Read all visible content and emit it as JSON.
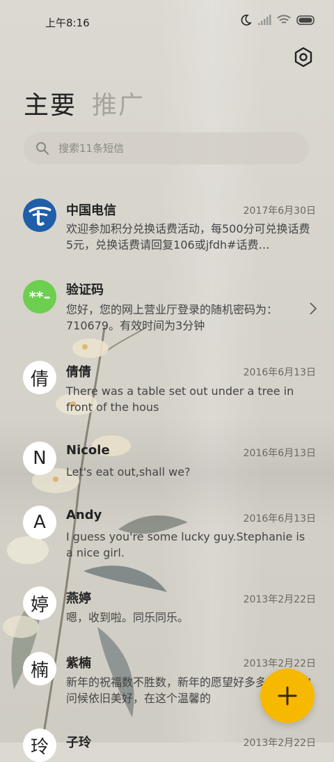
{
  "status": {
    "time": "上午8:16"
  },
  "tabs": [
    {
      "label": "主要"
    },
    {
      "label": "推广"
    }
  ],
  "search": {
    "placeholder": "搜索11条短信"
  },
  "conversations": [
    {
      "name": "中国电信",
      "date": "2017年6月30日",
      "snippet": "欢迎参加积分兑换话费活动，每500分可兑换话费5元，兑换话费请回复106或jfdh#话费…",
      "avatar": "",
      "avatar_type": "telecom-logo"
    },
    {
      "name": "验证码",
      "date": "",
      "snippet": "您好，您的网上营业厅登录的随机密码为：710679。有效时间为3分钟",
      "avatar": "**–",
      "avatar_type": "code",
      "avatar_color": "#6ccf4f"
    },
    {
      "name": "倩倩",
      "date": "2016年6月13日",
      "snippet": "There was a table set out under a tree in front of the hous",
      "avatar": "倩"
    },
    {
      "name": "Nicole",
      "date": "2016年6月13日",
      "snippet": "Let's eat out,shall we?",
      "avatar": "N"
    },
    {
      "name": "Andy",
      "date": "2016年6月13日",
      "snippet": "I guess you're some lucky guy.Stephanie is a nice girl.",
      "avatar": "A"
    },
    {
      "name": "燕婷",
      "date": "2013年2月22日",
      "snippet": "嗯，收到啦。同乐同乐。",
      "avatar": "婷"
    },
    {
      "name": "紫楠",
      "date": "2013年2月22日",
      "snippet": "新年的祝福数不胜数，新年的愿望好多多，新年的问候依旧美好，在这个温馨的",
      "avatar": "楠"
    },
    {
      "name": "子玲",
      "date": "2013年2月22日",
      "snippet": "",
      "avatar": "玲"
    }
  ],
  "colors": {
    "fab": "#f7b800",
    "accent": "#222222"
  },
  "icons": {
    "settings": "hexagon-settings-icon",
    "search": "search-icon",
    "compose": "plus-icon"
  }
}
